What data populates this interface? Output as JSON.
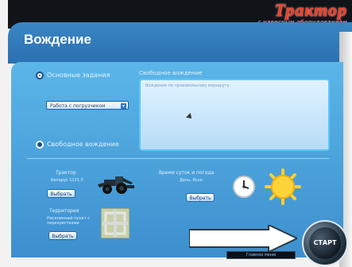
{
  "header": {
    "title": "Вождение",
    "logo_title": "Трактор",
    "logo_subtitle": "с навесным оборудованием"
  },
  "tasks": {
    "basic_label": "Основные задания",
    "dropdown_value": "Работа с погрузчиком",
    "free_label": "Свободное вождение"
  },
  "free_drive": {
    "title": "Свободное вождение",
    "placeholder": "Вождение по произвольному маршруту."
  },
  "vehicle": {
    "label": "Трактор",
    "sub": "Беларус 1221.3",
    "button_label": "Выбрать"
  },
  "territory": {
    "label": "Территория",
    "sub": "Населенный пункт с перекрестками",
    "button_label": "Выбрать"
  },
  "time_weather": {
    "label": "Время суток и погода",
    "sub": "День, Ясно",
    "button_label": "Выбрать"
  },
  "footer": {
    "strip_text": "Главное меню",
    "start_label": "СТАРТ"
  },
  "icons": {
    "tractor": "tractor-icon",
    "map": "map-thumbnail-icon",
    "clock": "clock-icon",
    "sun": "sun-icon",
    "arrow": "arrow-right-icon"
  },
  "colors": {
    "panel_top": "#5bb6e8",
    "panel_bottom": "#3d8fce",
    "logo": "#ff3b1f"
  }
}
